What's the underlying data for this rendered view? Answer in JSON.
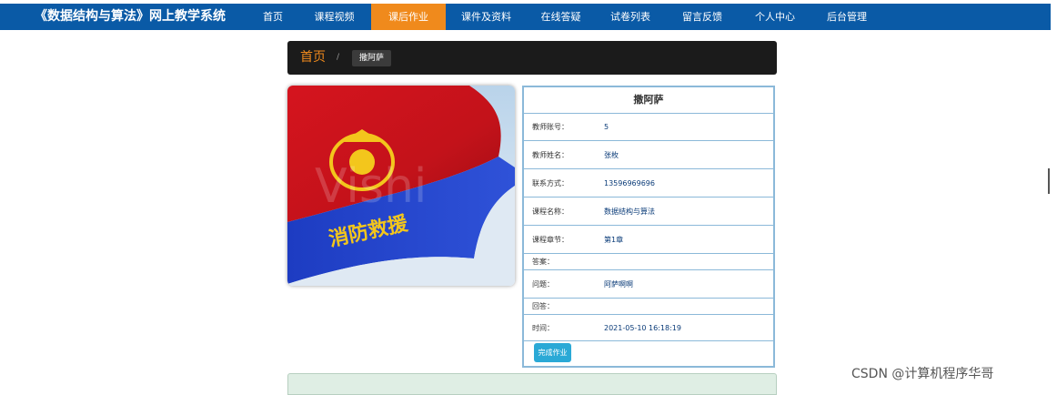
{
  "header": {
    "brand": "《数据结构与算法》网上教学系统",
    "nav": [
      {
        "label": "首页"
      },
      {
        "label": "课程视频"
      },
      {
        "label": "课后作业",
        "active": true
      },
      {
        "label": "课件及资料"
      },
      {
        "label": "在线答疑"
      },
      {
        "label": "试卷列表"
      },
      {
        "label": "留言反馈"
      },
      {
        "label": "个人中心"
      },
      {
        "label": "后台管理"
      }
    ]
  },
  "breadcrumb": {
    "home": "首页",
    "separator": "/",
    "current": "撒阿萨"
  },
  "picture": {
    "description_icon": "flag-image",
    "overlay_text": "Vishi"
  },
  "detail": {
    "title": "撒阿萨",
    "rows": [
      {
        "label": "教师账号：",
        "value": "5"
      },
      {
        "label": "教师姓名：",
        "value": "张枚"
      },
      {
        "label": "联系方式：",
        "value": "13596969696"
      },
      {
        "label": "课程名称：",
        "value": "数据结构与算法"
      },
      {
        "label": "课程章节：",
        "value": "第1章"
      },
      {
        "label": "答案：",
        "value": ""
      },
      {
        "label": "问题：",
        "value": "阿萨啊啊"
      },
      {
        "label": "回答：",
        "value": ""
      },
      {
        "label": "时间：",
        "value": "2021-05-10 16:18:19"
      }
    ],
    "submit_label": "完成作业"
  },
  "watermark": "CSDN @计算机程序华哥",
  "colors": {
    "nav_bg": "#0a5aa6",
    "nav_active": "#f08a1c",
    "crumb_bg": "#1b1b1b",
    "border": "#8bb9d9",
    "button": "#2aa9d6"
  }
}
